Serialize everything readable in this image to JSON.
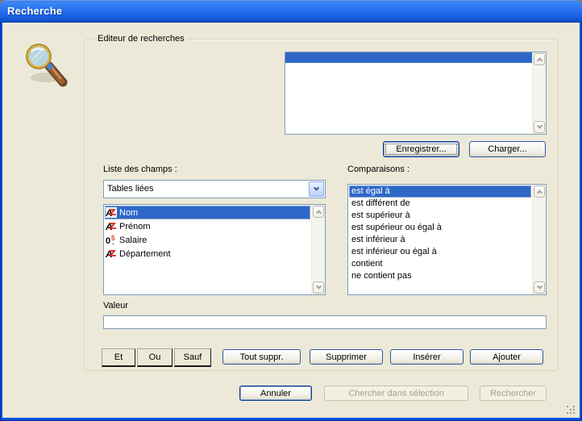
{
  "window": {
    "title": "Recherche"
  },
  "editor": {
    "group_label": "Editeur de recherches",
    "save_button": "Enregistrer...",
    "load_button": "Charger...",
    "fields_label": "Liste des champs :",
    "fields_combo": {
      "value": "Tables liées"
    },
    "fields": [
      {
        "label": "Nom",
        "type": "alpha",
        "selected": true
      },
      {
        "label": "Prénom",
        "type": "alpha",
        "selected": false
      },
      {
        "label": "Salaire",
        "type": "number",
        "selected": false
      },
      {
        "label": "Département",
        "type": "alpha",
        "selected": false
      }
    ],
    "comparisons_label": "Comparaisons :",
    "comparisons": [
      {
        "label": "est égal à",
        "selected": true
      },
      {
        "label": "est différent de",
        "selected": false
      },
      {
        "label": "est supérieur à",
        "selected": false
      },
      {
        "label": "est supérieur ou égal à",
        "selected": false
      },
      {
        "label": "est inférieur à",
        "selected": false
      },
      {
        "label": "est inférieur ou égal à",
        "selected": false
      },
      {
        "label": "contient",
        "selected": false
      },
      {
        "label": "ne contient pas",
        "selected": false
      }
    ],
    "value_label": "Valeur",
    "value_input": {
      "value": ""
    },
    "conjunctions": [
      "Et",
      "Ou",
      "Sauf"
    ],
    "actions": [
      "Tout suppr.",
      "Supprimer",
      "Insérer",
      "Ajouter"
    ]
  },
  "footer": {
    "cancel": "Annuler",
    "search_in_selection": "Chercher dans sélection",
    "search": "Rechercher"
  },
  "colors": {
    "titlebar_blue": "#2B77F0",
    "window_border": "#0B50DF",
    "dialog_bg": "#ECE9D8",
    "selection_blue": "#2D68C8",
    "button_border": "#2E55A3",
    "disabled_text": "#A3A095",
    "field_icon_red": "#D42A1E"
  }
}
